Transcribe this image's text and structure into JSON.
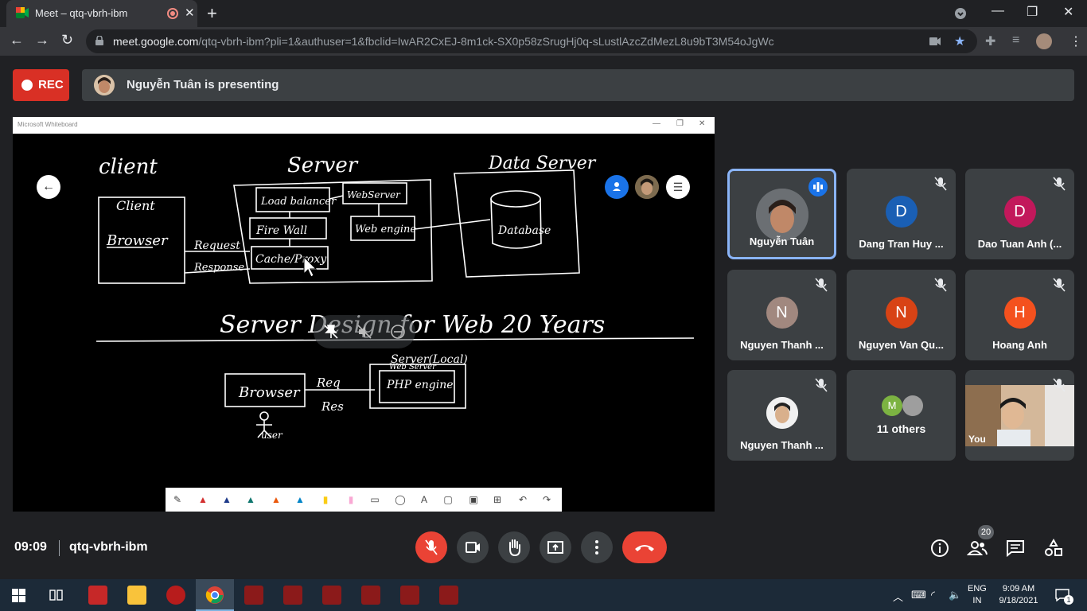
{
  "browser": {
    "tab_title": "Meet – qtq-vbrh-ibm",
    "url_host": "meet.google.com",
    "url_path": "/qtq-vbrh-ibm?pli=1&authuser=1&fbclid=IwAR2CxEJ-8m1ck-SX0p58zSrugHj0q-sLustlAzcZdMezL8u9bT3M54oJgWc"
  },
  "meet": {
    "rec_label": "REC",
    "presenting_text": "Nguyễn Tuân is presenting",
    "meeting_time": "09:09",
    "meeting_code": "qtq-vbrh-ibm",
    "people_count": "20"
  },
  "whiteboard": {
    "window_title": "Microsoft Whiteboard",
    "drawing_labels": {
      "client_title": "client",
      "client_box": "Client",
      "browser": "Browser",
      "request": "Request",
      "response": "Response",
      "server_title": "Server",
      "load_balancer": "Load balancer",
      "web_server": "WebServer",
      "fire_wall": "Fire Wall",
      "web_engine": "Web engine",
      "cache_proxy": "Cache/Proxy",
      "data_server_title": "Data Server",
      "database": "Database",
      "heading": "Server Design for Web 20 Years",
      "server_local": "Server(Local)",
      "browser2": "Browser",
      "req": "Req",
      "res": "Res",
      "web_server2": "Web Server",
      "php_engine": "PHP engine",
      "user": "user"
    }
  },
  "participants": [
    {
      "name": "Nguyễn Tuân",
      "initial": "",
      "color": "#5f6368",
      "speaking": true
    },
    {
      "name": "Dang Tran Huy ...",
      "initial": "D",
      "color": "#1a5fb4",
      "muted": true
    },
    {
      "name": "Dao Tuan Anh (...",
      "initial": "D",
      "color": "#c2185b",
      "muted": true
    },
    {
      "name": "Nguyen Thanh ...",
      "initial": "N",
      "color": "#a1887f",
      "muted": true
    },
    {
      "name": "Nguyen Van Qu...",
      "initial": "N",
      "color": "#d84315",
      "muted": true
    },
    {
      "name": "Hoang Anh",
      "initial": "H",
      "color": "#f4511e",
      "muted": true
    },
    {
      "name": "Nguyen Thanh ...",
      "initial": "",
      "color": "#e0e0e0",
      "muted": true
    },
    {
      "name": "11 others",
      "initial": "M",
      "color": "#7cb342"
    },
    {
      "name": "You",
      "initial": "",
      "color": "#c8a07a",
      "muted": true
    }
  ],
  "taskbar": {
    "lang_line1": "ENG",
    "lang_line2": "IN",
    "time": "9:09 AM",
    "date": "9/18/2021",
    "notification_count": "1"
  }
}
